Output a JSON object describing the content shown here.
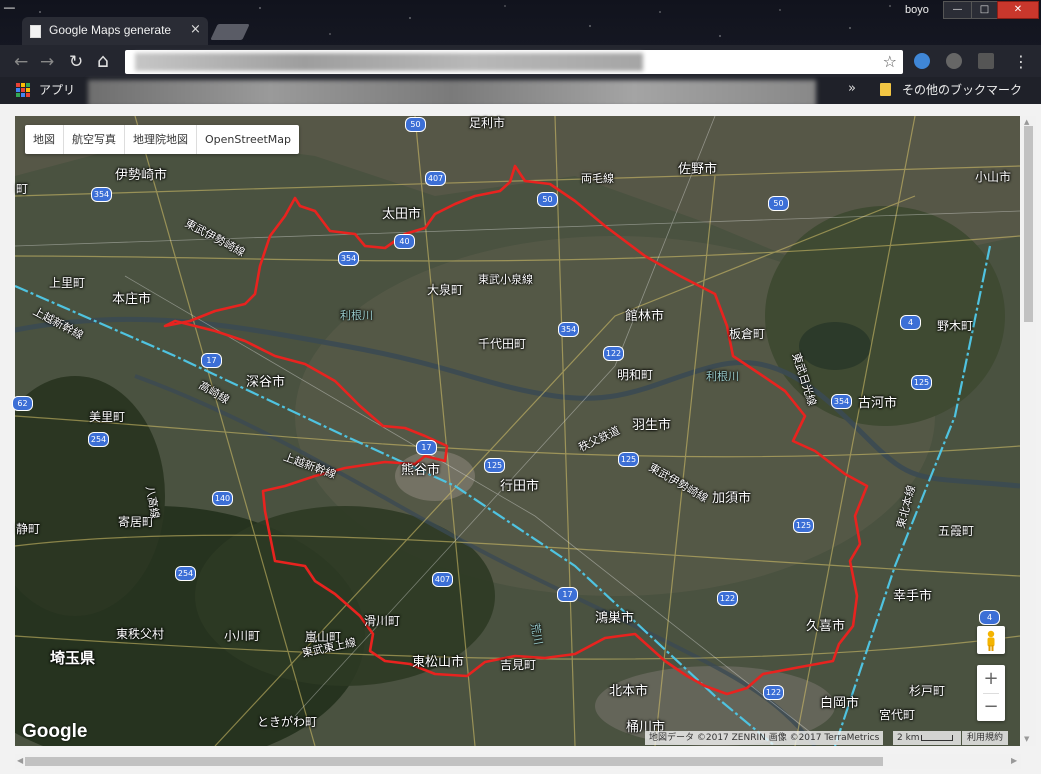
{
  "window": {
    "user": "boyo",
    "minimize": "—",
    "maximize": "□",
    "close": "✕"
  },
  "tab": {
    "title": "Google Maps generate",
    "close": "×"
  },
  "toolbar": {
    "back": "←",
    "forward": "→",
    "reload": "↻",
    "home": "⌂",
    "star": "☆",
    "menu": "⋮"
  },
  "bookmarks": {
    "apps_label": "アプリ",
    "chevron": "»",
    "other_label": "その他のブックマーク"
  },
  "map": {
    "type_buttons": [
      "地図",
      "航空写真",
      "地理院地図",
      "OpenStreetMap"
    ],
    "place_labels": [
      "足利市",
      "佐野市",
      "伊勢崎市",
      "太田市",
      "両毛線",
      "小山市",
      "東武伊勢崎線",
      "大泉町",
      "東武小泉線",
      "本庄市",
      "上里町",
      "上越新幹線",
      "館林市",
      "千代田町",
      "板倉町",
      "明和町",
      "深谷市",
      "高崎線",
      "東武日光線",
      "古河市",
      "美里町",
      "羽生市",
      "秩父鉄道",
      "熊谷市",
      "上越新幹線",
      "行田市",
      "東武伊勢崎線",
      "加須市",
      "寄居町",
      "八高線",
      "五霞町",
      "滑川町",
      "鴻巣市",
      "幸手市",
      "久喜市",
      "埼玉県",
      "東秩父村",
      "小川町",
      "嵐山町",
      "東武東上線",
      "東松山市",
      "吉見町",
      "北本市",
      "白岡市",
      "杉戸町",
      "宮代町",
      "桶川市",
      "ときがわ町",
      "野木町",
      "東北本線",
      "町",
      "静町",
      "利根川",
      "利根川",
      "荒川"
    ],
    "route_shields": [
      "50",
      "407",
      "354",
      "50",
      "50",
      "40",
      "354",
      "354",
      "122",
      "17",
      "125",
      "354",
      "17",
      "140",
      "125",
      "125",
      "254",
      "254",
      "407",
      "17",
      "122",
      "122",
      "4",
      "62",
      "4",
      "125"
    ],
    "google_logo": "Google",
    "attribution": "地図データ ©2017 ZENRIN 画像 ©2017 TerraMetrics",
    "scale_label": "2 km",
    "terms": "利用規約",
    "zoom_in": "+",
    "zoom_out": "−"
  },
  "colors": {
    "boundary": "#e8231f",
    "shinkansen": "#4fc3e0",
    "route_shield": "#3c6fd6"
  }
}
